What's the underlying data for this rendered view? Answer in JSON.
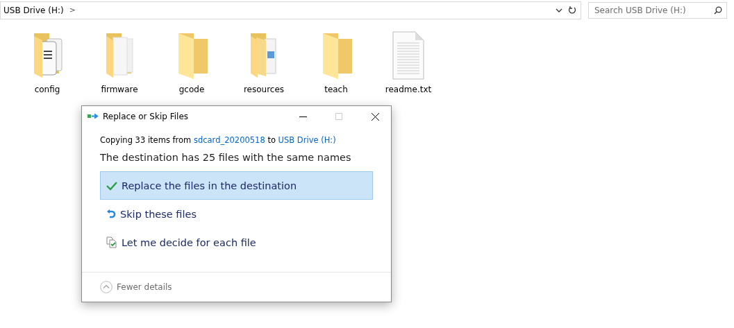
{
  "address_bar": {
    "path": "USB Drive (H:)",
    "separator": ">"
  },
  "search": {
    "placeholder": "Search USB Drive (H:)"
  },
  "items": [
    {
      "name": "config",
      "kind": "json-folder"
    },
    {
      "name": "firmware",
      "kind": "doc-folder"
    },
    {
      "name": "gcode",
      "kind": "folder"
    },
    {
      "name": "resources",
      "kind": "image-folder"
    },
    {
      "name": "teach",
      "kind": "folder"
    },
    {
      "name": "readme.txt",
      "kind": "text-file"
    }
  ],
  "dialog": {
    "title": "Replace or Skip Files",
    "copying": {
      "prefix": "Copying 33 items from",
      "source": "sdcard_20200518",
      "middle": "to",
      "destination": "USB Drive (H:)"
    },
    "heading": "The destination has 25 files with the same names",
    "options": [
      {
        "label": "Replace the files in the destination",
        "kind": "replace",
        "selected": true
      },
      {
        "label": "Skip these files",
        "kind": "skip",
        "selected": false
      },
      {
        "label": "Let me decide for each file",
        "kind": "decide",
        "selected": false
      }
    ],
    "details": {
      "label": "Fewer details",
      "expanded": true
    }
  }
}
